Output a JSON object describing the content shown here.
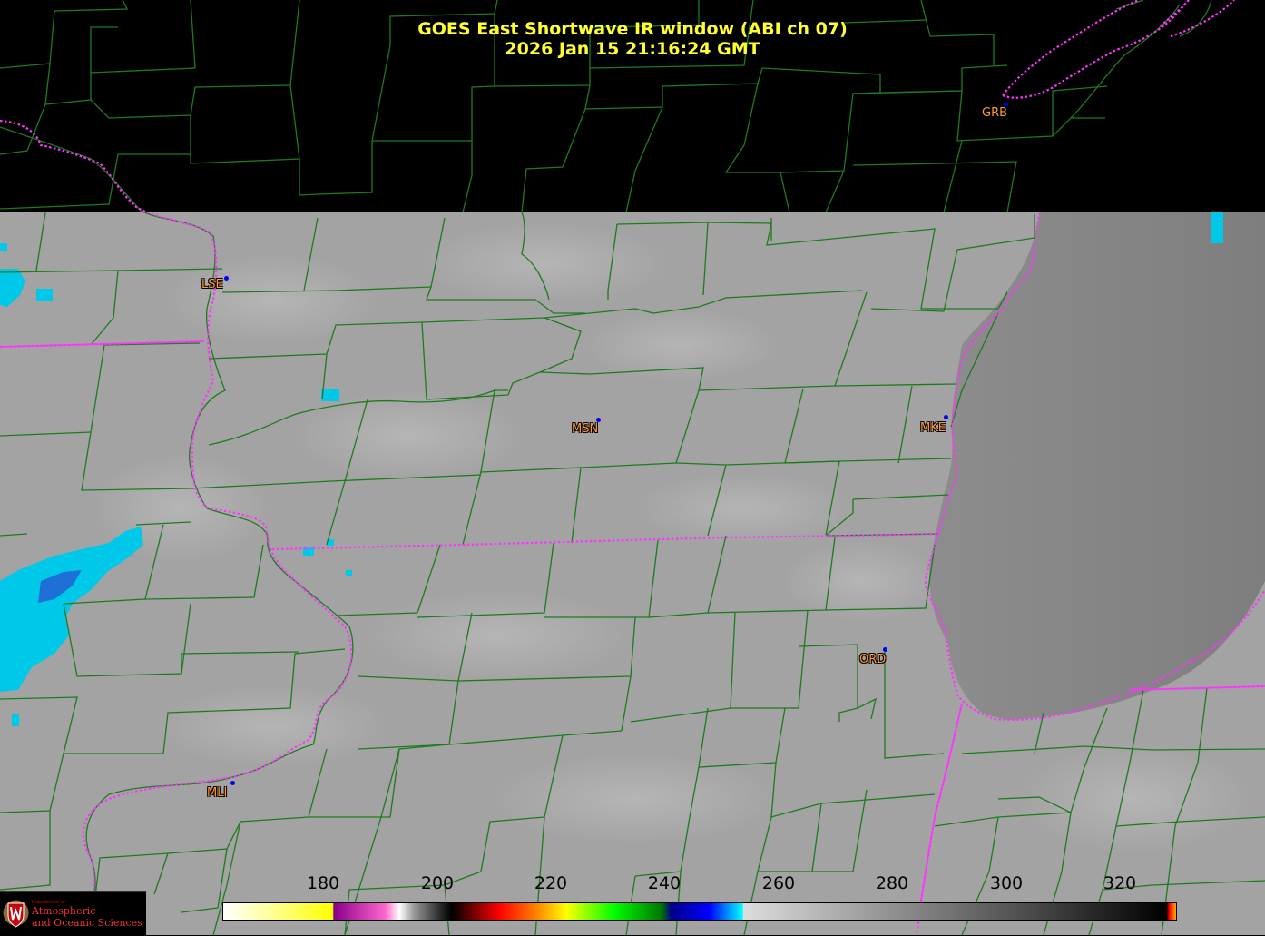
{
  "title": {
    "line1": "GOES East Shortwave IR window (ABI ch 07)",
    "line2": "2026 Jan 15  21:16:24 GMT"
  },
  "stations": [
    {
      "code": "GRB"
    },
    {
      "code": "LSE"
    },
    {
      "code": "MSN"
    },
    {
      "code": "MKE"
    },
    {
      "code": "ORD"
    },
    {
      "code": "MLI"
    }
  ],
  "colorbar": {
    "ticks": [
      "180",
      "200",
      "220",
      "240",
      "260",
      "280",
      "300",
      "320"
    ]
  },
  "logo": {
    "small_text": "Department of",
    "line1": "Atmospheric",
    "line2": "and Oceanic Sciences"
  },
  "colors": {
    "title": "#ffff33",
    "county_lines": "#1f7a1f",
    "state_borders": "#ff33ff",
    "station_label": "#ff9a33",
    "station_dot": "#0000ee",
    "cold_cloud": "#00ddff"
  }
}
